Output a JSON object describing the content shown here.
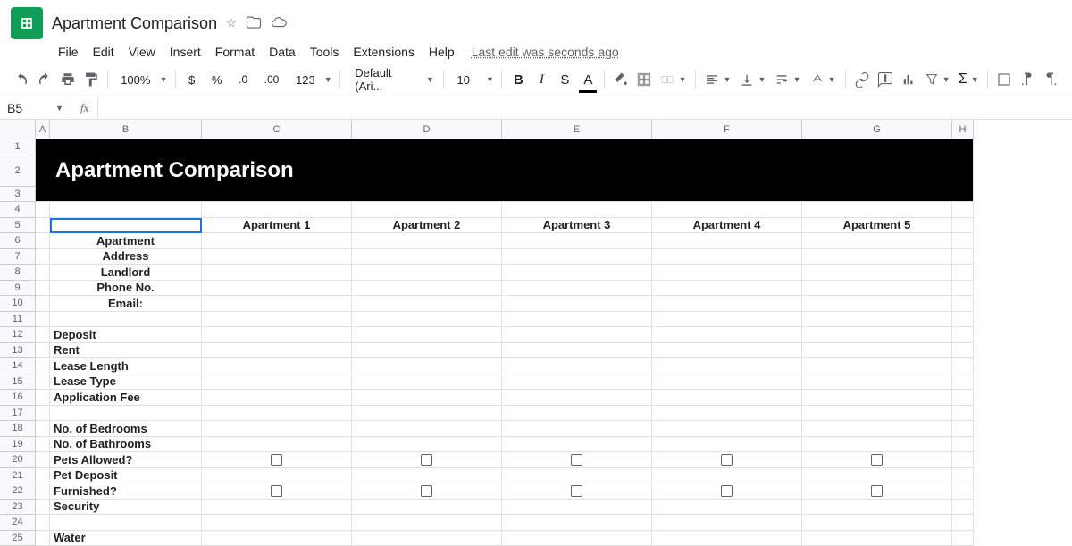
{
  "doc": {
    "title": "Apartment Comparison"
  },
  "menubar": {
    "items": [
      "File",
      "Edit",
      "View",
      "Insert",
      "Format",
      "Data",
      "Tools",
      "Extensions",
      "Help"
    ],
    "last_edit": "Last edit was seconds ago"
  },
  "toolbar": {
    "zoom": "100%",
    "font": "Default (Ari...",
    "font_size": "10",
    "format_number": "123"
  },
  "namebox": {
    "value": "B5"
  },
  "formula": {
    "value": ""
  },
  "columns": [
    "A",
    "B",
    "C",
    "D",
    "E",
    "F",
    "G",
    "H"
  ],
  "rows": [
    "1",
    "2",
    "3",
    "4",
    "5",
    "6",
    "7",
    "8",
    "9",
    "10",
    "11",
    "12",
    "13",
    "14",
    "15",
    "16",
    "17",
    "18",
    "19",
    "20",
    "21",
    "22",
    "23",
    "24",
    "25"
  ],
  "spreadsheet": {
    "title_text": "Apartment Comparison",
    "headers": [
      "Apartment 1",
      "Apartment 2",
      "Apartment 3",
      "Apartment 4",
      "Apartment 5"
    ],
    "labels": {
      "apartment": "Apartment",
      "address": "Address",
      "landlord": "Landlord",
      "phone": "Phone No.",
      "email": "Email:",
      "deposit": "Deposit",
      "rent": "Rent",
      "lease_length": "Lease Length",
      "lease_type": "Lease Type",
      "application_fee": "Application Fee",
      "bedrooms": "No. of Bedrooms",
      "bathrooms": "No. of Bathrooms",
      "pets_allowed": "Pets Allowed?",
      "pet_deposit": "Pet Deposit",
      "furnished": "Furnished?",
      "security": "Security",
      "water": "Water"
    }
  }
}
